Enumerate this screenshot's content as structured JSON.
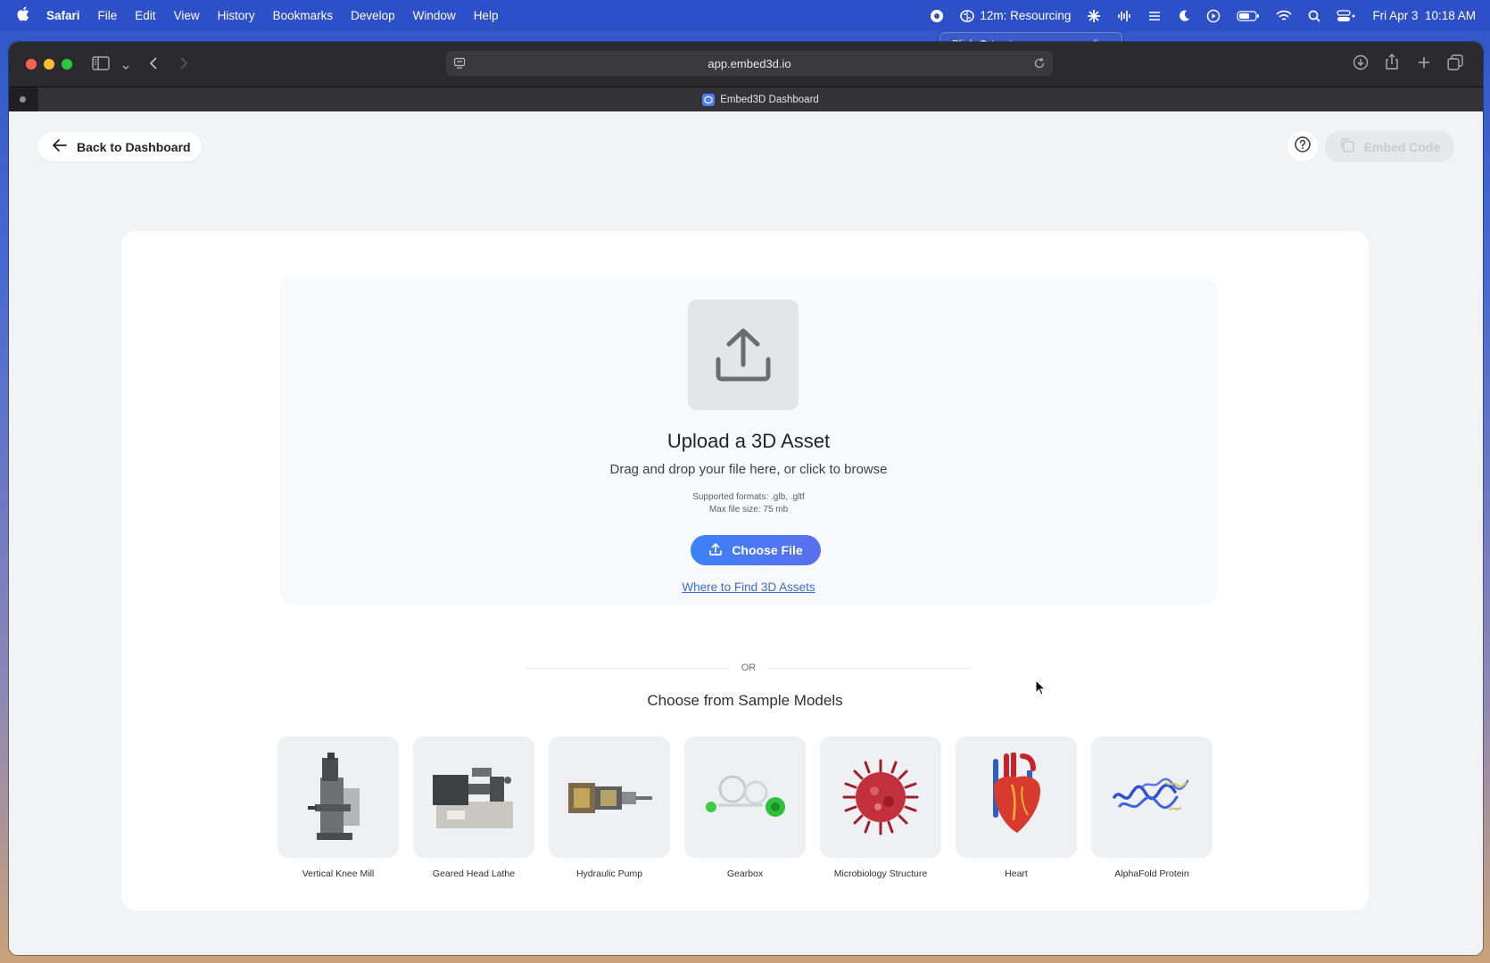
{
  "menubar": {
    "app": "Safari",
    "items": [
      "File",
      "Edit",
      "View",
      "History",
      "Bookmarks",
      "Develop",
      "Window",
      "Help"
    ],
    "status_timer": "12m: Resourcing",
    "datetime": "Fri Apr 3  10:18 AM"
  },
  "recording_tooltip": {
    "prefix": "Click",
    "suffix": "to stop screen recording"
  },
  "browser": {
    "url": "app.embed3d.io",
    "tab_title": "Embed3D Dashboard"
  },
  "header": {
    "back_label": "Back to Dashboard",
    "embed_label": "Embed Code"
  },
  "upload": {
    "title": "Upload a 3D Asset",
    "subtitle": "Drag and drop your file here, or click to browse",
    "formats": "Supported formats: .glb, .gltf",
    "max_size": "Max file size: 75 mb",
    "choose_label": "Choose File",
    "where_link": "Where to Find 3D Assets"
  },
  "divider": "OR",
  "samples": {
    "title": "Choose from Sample Models",
    "items": [
      {
        "label": "Vertical Knee Mill",
        "icon": "mill-icon"
      },
      {
        "label": "Geared Head Lathe",
        "icon": "lathe-icon"
      },
      {
        "label": "Hydraulic Pump",
        "icon": "pump-icon"
      },
      {
        "label": "Gearbox",
        "icon": "gearbox-icon"
      },
      {
        "label": "Microbiology Structure",
        "icon": "virus-icon"
      },
      {
        "label": "Heart",
        "icon": "heart-icon"
      },
      {
        "label": "AlphaFold Protein",
        "icon": "protein-icon"
      }
    ]
  },
  "colors": {
    "accent": "#3b82f6",
    "link": "#3b6fd8",
    "menubar": "#2d50c8"
  }
}
